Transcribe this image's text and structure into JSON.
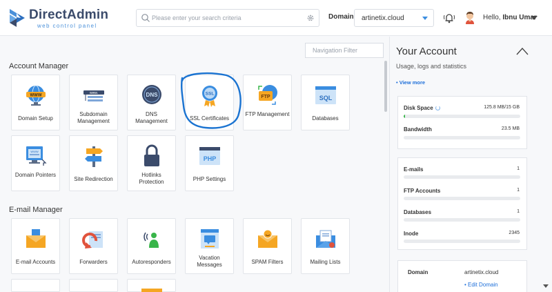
{
  "header": {
    "logo_title": "DirectAdmin",
    "logo_subtitle": "web control panel",
    "search_placeholder": "Please enter your search criteria",
    "domain_label": "Domain",
    "domain_value": "artinetix.cloud",
    "hello_prefix": "Hello,",
    "user_name": "Ibnu Umar"
  },
  "nav_filter_placeholder": "Navigation Filter",
  "sections": {
    "account_manager": "Account Manager",
    "email_manager": "E-mail Manager"
  },
  "account_tiles": [
    {
      "label": "Domain Setup",
      "icon": "www-globe-icon"
    },
    {
      "label": "Subdomain Management",
      "icon": "subdomain-icon"
    },
    {
      "label": "DNS Management",
      "icon": "dns-icon"
    },
    {
      "label": "SSL Certificates",
      "icon": "ssl-badge-icon"
    },
    {
      "label": "FTP Management",
      "icon": "ftp-icon"
    },
    {
      "label": "Databases",
      "icon": "sql-icon"
    },
    {
      "label": "Domain Pointers",
      "icon": "domain-pointer-icon"
    },
    {
      "label": "Site Redirection",
      "icon": "signpost-icon"
    },
    {
      "label": "Hotlinks Protection",
      "icon": "lock-icon"
    },
    {
      "label": "PHP Settings",
      "icon": "php-icon"
    }
  ],
  "email_tiles": [
    {
      "label": "E-mail Accounts",
      "icon": "envelope-icon"
    },
    {
      "label": "Forwarders",
      "icon": "forward-icon"
    },
    {
      "label": "Autoresponders",
      "icon": "autoresponder-icon"
    },
    {
      "label": "Vacation Messages",
      "icon": "vacation-icon"
    },
    {
      "label": "SPAM Filters",
      "icon": "spam-filter-icon"
    },
    {
      "label": "Mailing Lists",
      "icon": "mailing-list-icon"
    }
  ],
  "your_account": {
    "title": "Your Account",
    "subtitle": "Usage, logs and statistics",
    "view_more": "• View more",
    "disk_space_label": "Disk Space",
    "disk_space_value": "125.8 MB/15 GB",
    "disk_space_fraction": 0.01,
    "bandwidth_label": "Bandwidth",
    "bandwidth_value": "23.5 MB",
    "bandwidth_fraction": 0,
    "emails_label": "E-mails",
    "emails_value": "1",
    "ftp_label": "FTP Accounts",
    "ftp_value": "1",
    "databases_label": "Databases",
    "databases_value": "1",
    "inode_label": "Inode",
    "inode_value": "2345",
    "domain_label": "Domain",
    "domain_value": "artinetix.cloud",
    "edit_domain": "• Edit Domain"
  },
  "colors": {
    "accent": "#1e6fd9",
    "progress": "#39b54a",
    "annotation": "#1a73d1"
  }
}
